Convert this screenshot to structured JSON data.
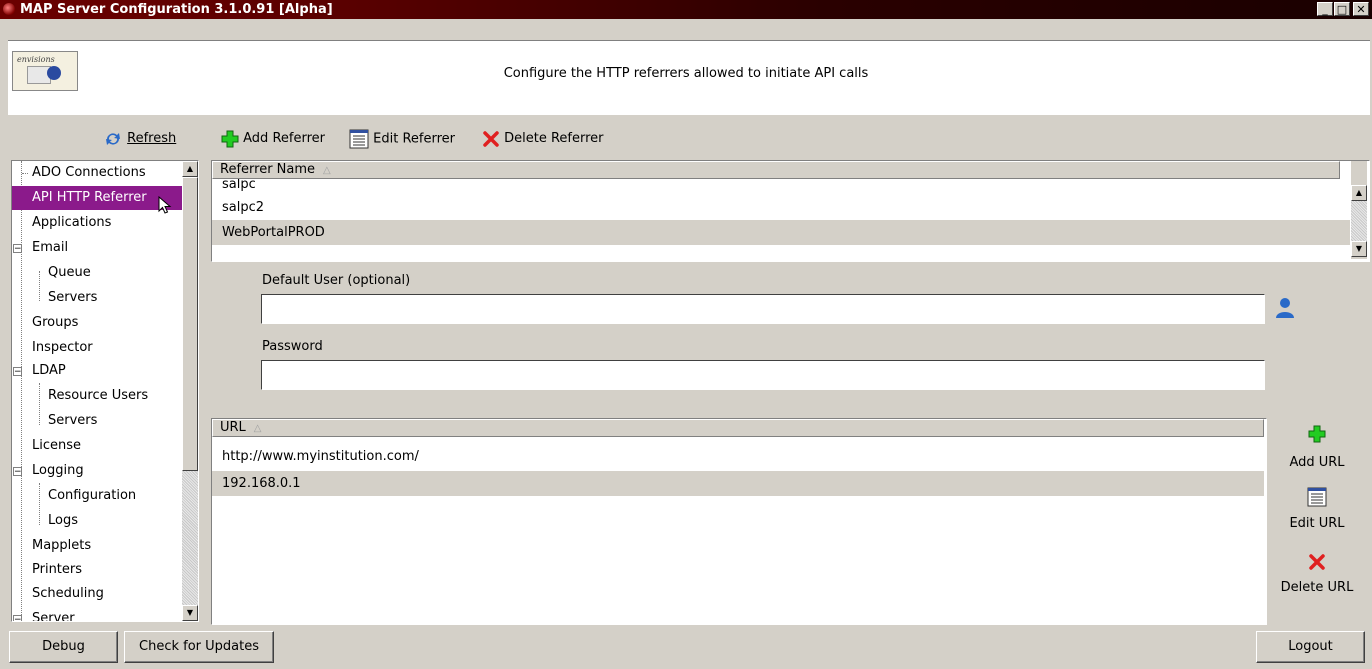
{
  "window": {
    "title": "MAP Server Configuration 3.1.0.91 [Alpha]",
    "controls": {
      "minimize": "_",
      "maximize": "□",
      "close": "✕"
    }
  },
  "header": {
    "logo_text": "envisions",
    "description": "Configure the HTTP referrers allowed to initiate API calls"
  },
  "toolbar": {
    "refresh_label": "Refresh",
    "add_referrer_label": "Add Referrer",
    "edit_referrer_label": "Edit Referrer",
    "delete_referrer_label": "Delete Referrer"
  },
  "tree": {
    "items": [
      {
        "label": "ADO Connections",
        "level": 0
      },
      {
        "label": "API HTTP Referrer",
        "level": 0,
        "selected": true
      },
      {
        "label": "Applications",
        "level": 0
      },
      {
        "label": "Email",
        "level": 0,
        "expanded": true
      },
      {
        "label": "Queue",
        "level": 1
      },
      {
        "label": "Servers",
        "level": 1
      },
      {
        "label": "Groups",
        "level": 0
      },
      {
        "label": "Inspector",
        "level": 0
      },
      {
        "label": "LDAP",
        "level": 0,
        "expanded": true
      },
      {
        "label": "Resource Users",
        "level": 1
      },
      {
        "label": "Servers",
        "level": 1
      },
      {
        "label": "License",
        "level": 0
      },
      {
        "label": "Logging",
        "level": 0,
        "expanded": true
      },
      {
        "label": "Configuration",
        "level": 1
      },
      {
        "label": "Logs",
        "level": 1
      },
      {
        "label": "Mapplets",
        "level": 0
      },
      {
        "label": "Printers",
        "level": 0
      },
      {
        "label": "Scheduling",
        "level": 0
      },
      {
        "label": "Server",
        "level": 0,
        "expanded": true
      }
    ]
  },
  "referrers": {
    "column_header": "Referrer Name",
    "sort_indicator": "△",
    "rows": [
      "salpc",
      "salpc2",
      "WebPortalPROD"
    ]
  },
  "form": {
    "default_user_label": "Default User (optional)",
    "default_user_value": "",
    "password_label": "Password",
    "password_value": ""
  },
  "urls": {
    "column_header": "URL",
    "sort_indicator": "△",
    "rows": [
      "http://www.myinstitution.com/",
      "192.168.0.1"
    ],
    "add_label": "Add URL",
    "edit_label": "Edit URL",
    "delete_label": "Delete URL"
  },
  "footer": {
    "debug_label": "Debug",
    "check_updates_label": "Check for Updates",
    "logout_label": "Logout"
  },
  "colors": {
    "title_bar": "#6b0000",
    "selection": "#8b1a8b",
    "add_icon": "#22cc22",
    "delete_icon": "#e02020",
    "refresh_icon": "#2a6ac8",
    "user_icon": "#2a6ac8"
  }
}
